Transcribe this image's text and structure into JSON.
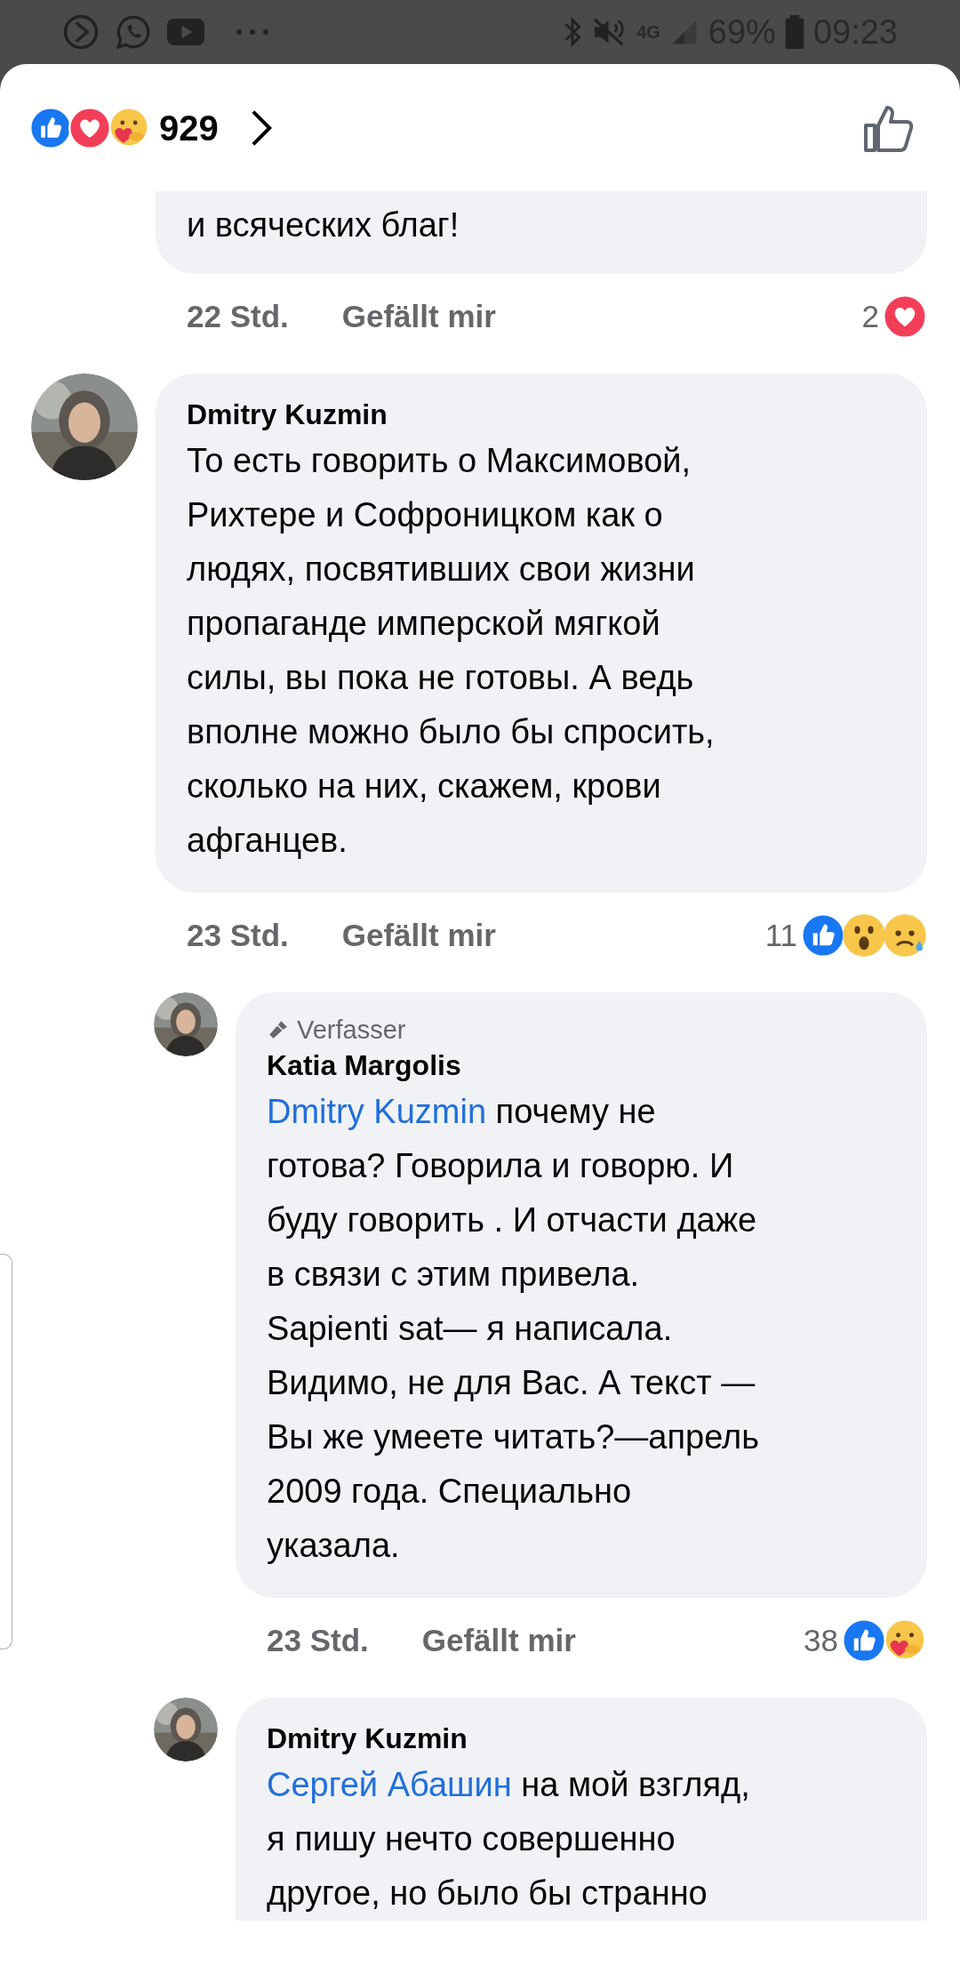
{
  "status_bar": {
    "network": "4G",
    "battery": "69%",
    "time": "09:23"
  },
  "header": {
    "reactions": [
      {
        "kind": "like"
      },
      {
        "kind": "love"
      },
      {
        "kind": "care"
      }
    ],
    "reaction_count": "929"
  },
  "comments": [
    {
      "kind": "tail",
      "lines": [
        "и всяческих благ!"
      ],
      "time": "22 Std.",
      "like_label": "Gefällt mir",
      "reaction_count": "2",
      "reactions": [
        {
          "kind": "love"
        }
      ]
    },
    {
      "kind": "top",
      "author": "Dmitry Kuzmin",
      "lines": [
        "То есть говорить о Максимовой,",
        "Рихтере и Софроницком как о",
        "людях, посвятивших свои жизни",
        "пропаганде имперской мягкой",
        "силы, вы пока не готовы. А ведь",
        "вполне можно было бы спросить,",
        "сколько на них, скажем, крови",
        "афганцев."
      ],
      "time": "23 Std.",
      "like_label": "Gefällt mir",
      "reaction_count": "11",
      "reactions": [
        {
          "kind": "like"
        },
        {
          "kind": "wow"
        },
        {
          "kind": "sad"
        }
      ]
    },
    {
      "kind": "reply",
      "badge": "Verfasser",
      "author": "Katia Margolis",
      "mention": "Dmitry Kuzmin",
      "lines": [
        " почему не",
        "готова? Говорила и говорю. И",
        "буду говорить . И отчасти даже",
        "в связи с этим привела.",
        "Sapienti sat— я написала.",
        "Видимо, не для Вас. А текст —",
        "Вы же умеете читать?—апрель",
        "2009 года. Специально",
        "указала."
      ],
      "time": "23 Std.",
      "like_label": "Gefällt mir",
      "reaction_count": "38",
      "reactions": [
        {
          "kind": "like"
        },
        {
          "kind": "care"
        }
      ]
    },
    {
      "kind": "reply",
      "author": "Dmitry Kuzmin",
      "mention": "Сергей Абашин",
      "lines": [
        " на мой взгляд,",
        "я пишу нечто совершенно",
        "другое, но было бы странно"
      ]
    }
  ]
}
